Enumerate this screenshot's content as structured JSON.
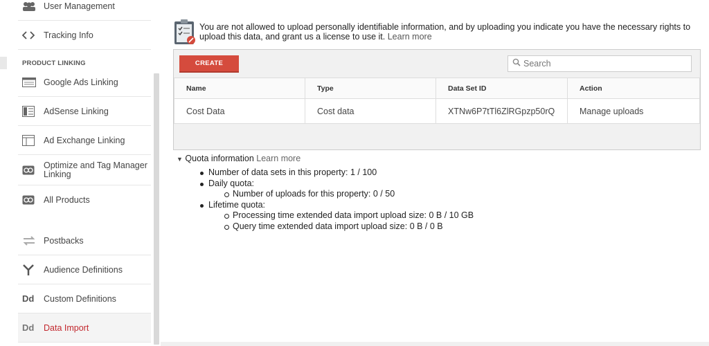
{
  "sidebar": {
    "items_top": [
      {
        "label": "User Management",
        "icon": "users-icon"
      },
      {
        "label": "Tracking Info",
        "icon": "code-icon"
      }
    ],
    "section_label": "PRODUCT LINKING",
    "items": [
      {
        "label": "Google Ads Linking",
        "icon": "ads-icon"
      },
      {
        "label": "AdSense Linking",
        "icon": "adsense-icon"
      },
      {
        "label": "Ad Exchange Linking",
        "icon": "adexchange-icon"
      },
      {
        "label": "Optimize and Tag Manager Linking",
        "icon": "link-icon"
      },
      {
        "label": "All Products",
        "icon": "link-icon"
      },
      {
        "label": "Postbacks",
        "icon": "postbacks-icon"
      },
      {
        "label": "Audience Definitions",
        "icon": "audience-icon"
      },
      {
        "label": "Custom Definitions",
        "icon": "dd-icon"
      },
      {
        "label": "Data Import",
        "icon": "dd-icon"
      }
    ],
    "dd_glyph": "Dd"
  },
  "notice": {
    "text": "You are not allowed to upload personally identifiable information, and by uploading you indicate you have the necessary rights to upload this data, and grant us a license to use it.",
    "link": "Learn more"
  },
  "toolbar": {
    "create_label": "CREATE",
    "search_placeholder": "Search"
  },
  "table": {
    "headers": [
      "Name",
      "Type",
      "Data Set ID",
      "Action"
    ],
    "rows": [
      [
        "Cost Data",
        "Cost data",
        "XTNw6P7tTl6ZlRGpzp50rQ",
        "Manage uploads"
      ]
    ]
  },
  "quota": {
    "title": "Quota information",
    "link": "Learn more",
    "data_sets": "Number of data sets in this property: 1 / 100",
    "daily": "Daily quota:",
    "uploads": "Number of uploads for this property: 0 / 50",
    "lifetime": "Lifetime quota:",
    "processing": "Processing time extended data import upload size: 0 B / 10 GB",
    "query": "Query time extended data import upload size: 0 B / 0 B"
  },
  "colors": {
    "accent": "#d54b3d",
    "active_text": "#c2272d"
  }
}
